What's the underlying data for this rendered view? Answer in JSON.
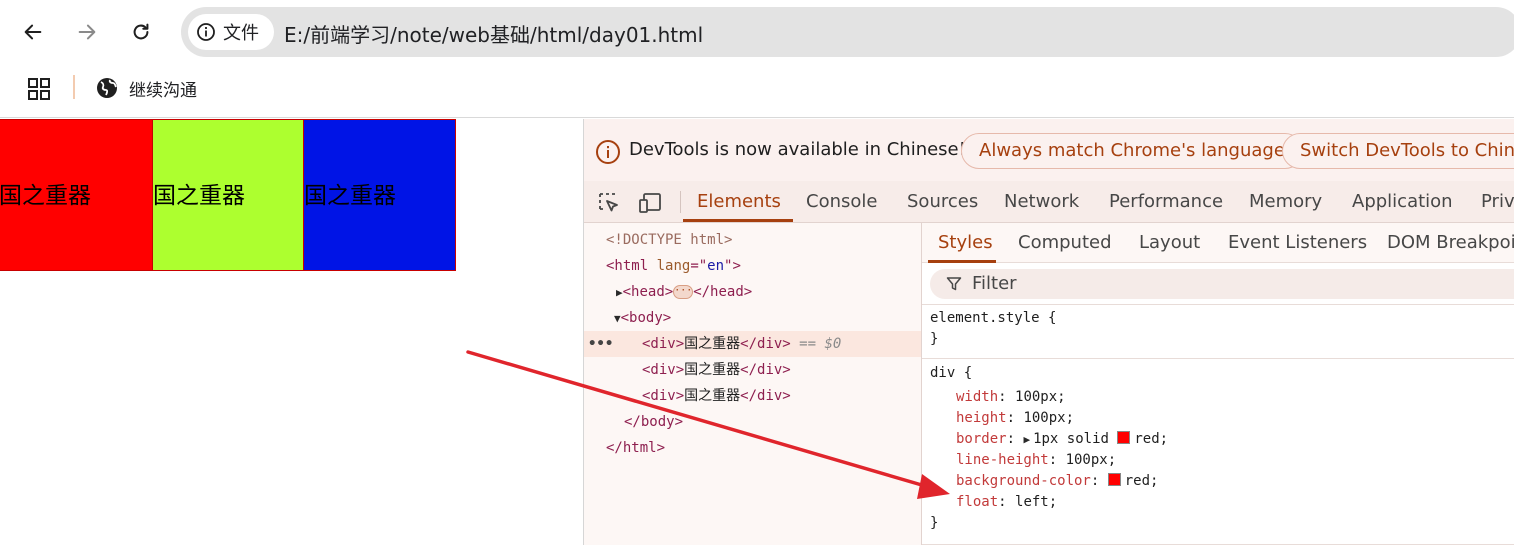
{
  "browser": {
    "url": "E:/前端学习/note/web基础/html/day01.html",
    "site_chip_label": "文件",
    "bookmark_label": "继续沟通"
  },
  "page": {
    "boxes": [
      {
        "text": "国之重器",
        "color": "#ff0000"
      },
      {
        "text": "国之重器",
        "color": "#adff2f"
      },
      {
        "text": "国之重器",
        "color": "#0014e6"
      }
    ]
  },
  "devtools": {
    "infobar": {
      "message": "DevTools is now available in Chinese!",
      "match_button": "Always match Chrome's language",
      "switch_button": "Switch DevTools to Chinese"
    },
    "tabs": [
      "Elements",
      "Console",
      "Sources",
      "Network",
      "Performance",
      "Memory",
      "Application",
      "Privacy"
    ],
    "active_tab": "Elements",
    "dom": {
      "doctype": "<!DOCTYPE html>",
      "html_open_tag": "<html",
      "html_attr_name": "lang",
      "html_attr_eq": "=\"",
      "html_attr_value": "en",
      "html_attr_close": "\">",
      "head_open": "<head>",
      "head_close": "</head>",
      "body_open": "<body>",
      "div_open": "<div>",
      "div_text": "国之重器",
      "div_close": "</div>",
      "selected_marker": "== $0",
      "body_close": "</body>",
      "html_close": "</html>"
    },
    "styles": {
      "subtabs": [
        "Styles",
        "Computed",
        "Layout",
        "Event Listeners",
        "DOM Breakpoints"
      ],
      "filter_placeholder": "Filter",
      "element_style_selector": "element.style {",
      "close_brace": "}",
      "div_selector": "div {",
      "properties": [
        {
          "name": "width",
          "value": "100px;"
        },
        {
          "name": "height",
          "value": "100px;"
        },
        {
          "name": "border",
          "value": "1px solid",
          "color_value": "red;"
        },
        {
          "name": "line-height",
          "value": "100px;"
        },
        {
          "name": "background-color",
          "value": "",
          "color_value": "red;"
        },
        {
          "name": "float",
          "value": "left;"
        }
      ]
    }
  },
  "colors": {
    "accent": "#a6400f",
    "annotation_arrow": "#e0252c"
  }
}
